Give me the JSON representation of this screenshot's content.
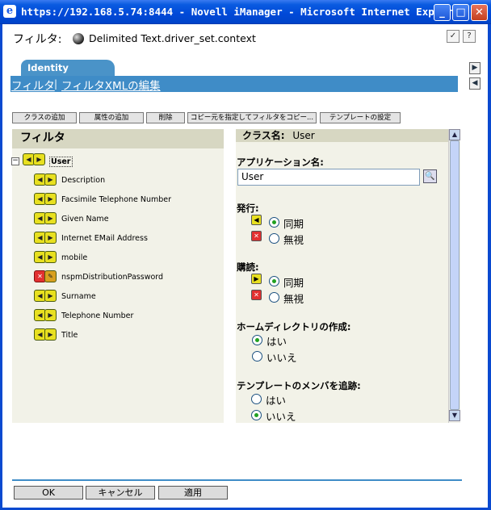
{
  "window": {
    "title": "https://192.168.5.74:8444 - Novell iManager - Microsoft Internet Explorer",
    "minimize": "_",
    "maximize": "□",
    "close": "✕"
  },
  "header": {
    "label": "フィルタ:",
    "object": "Delimited Text.driver_set.context",
    "icon": "yin-yang-icon"
  },
  "tab": {
    "label": "Identity Manager"
  },
  "nav": {
    "filter_link": "フィルタ",
    "separator": "|",
    "xml_link": "フィルタXMLの編集"
  },
  "toolbar": {
    "add_class": "クラスの追加",
    "add_attr": "属性の追加",
    "delete": "削除",
    "copy": "コピー元を指定してフィルタをコピー...",
    "template": "テンプレートの設定"
  },
  "filter_tree": {
    "title": "フィルタ",
    "class": "User",
    "attributes": [
      {
        "name": "Description",
        "state": "sync"
      },
      {
        "name": "Facsimile Telephone Number",
        "state": "sync"
      },
      {
        "name": "Given Name",
        "state": "sync"
      },
      {
        "name": "Internet EMail Address",
        "state": "sync"
      },
      {
        "name": "mobile",
        "state": "sync"
      },
      {
        "name": "nspmDistributionPassword",
        "state": "block"
      },
      {
        "name": "Surname",
        "state": "sync"
      },
      {
        "name": "Telephone Number",
        "state": "sync"
      },
      {
        "name": "Title",
        "state": "sync"
      }
    ]
  },
  "details": {
    "class_label": "クラス名:",
    "class_name": "User",
    "app_name_label": "アプリケーション名:",
    "app_name_value": "User",
    "publish_label": "発行:",
    "subscribe_label": "購読:",
    "sync": "同期",
    "ignore": "無視",
    "home_dir_label": "ホームディレクトリの作成:",
    "template_label": "テンプレートのメンバを追跡:",
    "yes": "はい",
    "no": "いいえ",
    "publish_selected": "sync",
    "subscribe_selected": "sync",
    "home_dir_selected": "yes",
    "template_selected": "no"
  },
  "footer": {
    "ok": "OK",
    "cancel": "キャンセル",
    "apply": "適用"
  }
}
